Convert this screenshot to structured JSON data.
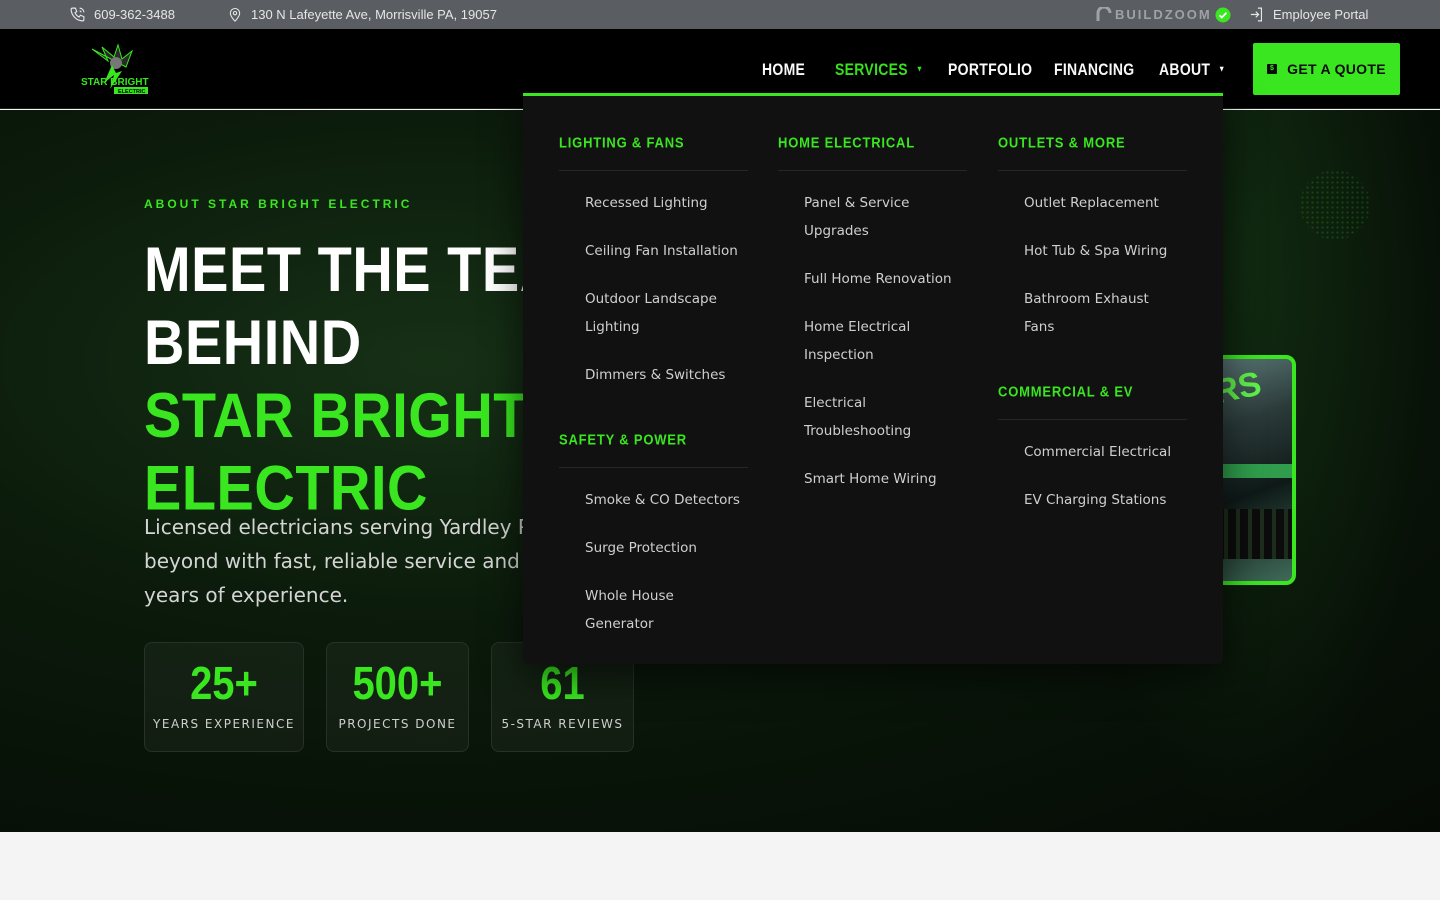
{
  "topbar": {
    "phone": "609-362-3488",
    "address": "130 N Lafeyette Ave, Morrisville PA, 19057",
    "buildzoom": "BUILDZOOM",
    "employee_portal": "Employee Portal"
  },
  "nav": {
    "logo_text": "STAR BRIGHT",
    "logo_sub": "ELECTRIC",
    "home": "HOME",
    "services": "SERVICES",
    "portfolio": "PORTFOLIO",
    "financing": "FINANCING",
    "about": "ABOUT",
    "quote": "GET A QUOTE"
  },
  "hero": {
    "eyebrow": "ABOUT STAR BRIGHT ELECTRIC",
    "line1": "MEET THE TEAM",
    "line2": "BEHIND",
    "line3": "STAR BRIGHT",
    "line4": "ELECTRIC",
    "description": "Licensed electricians serving Yardley PA and beyond with fast, reliable service and over 25 years of experience."
  },
  "stats": [
    {
      "value": "25+",
      "label": "YEARS EXPERIENCE"
    },
    {
      "value": "500+",
      "label": "PROJECTS DONE"
    },
    {
      "value": "61",
      "label": "5-STAR REVIEWS"
    }
  ],
  "mega_menu": {
    "lighting": {
      "title": "LIGHTING & FANS",
      "items": [
        "Recessed Lighting",
        "Ceiling Fan Installation",
        "Outdoor Landscape Lighting",
        "Dimmers & Switches"
      ]
    },
    "safety": {
      "title": "SAFETY & POWER",
      "items": [
        "Smoke & CO Detectors",
        "Surge Protection",
        "Whole House Generator"
      ]
    },
    "home": {
      "title": "HOME ELECTRICAL",
      "items": [
        "Panel & Service Upgrades",
        "Full Home Renovation",
        "Home Electrical Inspection",
        "Electrical Troubleshooting",
        "Smart Home Wiring"
      ]
    },
    "outlets": {
      "title": "OUTLETS & MORE",
      "items": [
        "Outlet Replacement",
        "Hot Tub & Spa Wiring",
        "Bathroom Exhaust Fans"
      ]
    },
    "commercial": {
      "title": "COMMERCIAL & EV",
      "items": [
        "Commercial Electrical",
        "EV Charging Stations"
      ]
    }
  },
  "colors": {
    "accent": "#39e61f",
    "topbar": "#5a5d61",
    "nav": "#000000",
    "menu": "#111111"
  }
}
